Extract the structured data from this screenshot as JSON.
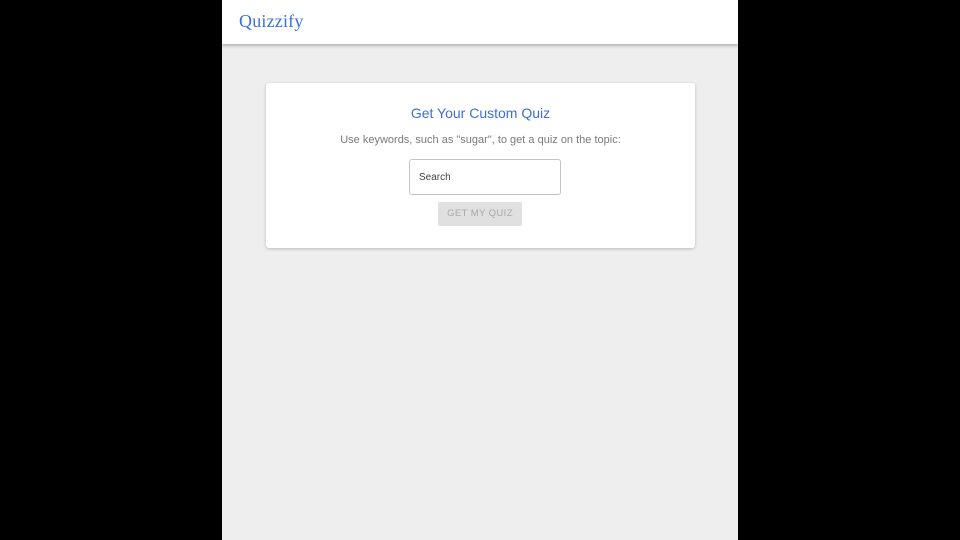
{
  "app": {
    "brand": "Quizzify"
  },
  "quiz_card": {
    "title": "Get Your Custom Quiz",
    "description": "Use keywords, such as \"sugar\", to get a quiz on the topic:",
    "search": {
      "placeholder": "Search",
      "value": ""
    },
    "submit_label": "GET MY QUIZ",
    "submit_disabled": true
  },
  "colors": {
    "brand": "#3b6fd6",
    "page_background": "#eeeeee",
    "surface": "#ffffff",
    "outer_background": "#000000",
    "disabled_button": "#e0e0e0",
    "disabled_text": "#a8a8a8"
  }
}
